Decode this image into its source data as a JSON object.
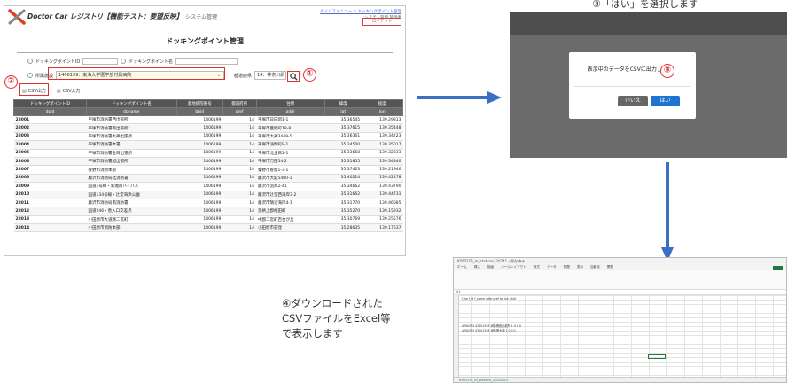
{
  "app": {
    "title": "Doctor Car レジストリ【機能テスト：要望反映】",
    "subtitle": "システム管理",
    "header_links": "ダイバスメニュー > ドッキングポイント管理",
    "header_user": "システム管理 管理者",
    "logout_label": "ログアウト",
    "page_title": "ドッキングポイント管理",
    "form": {
      "radio1_label": "ドッキングポイントID",
      "radio2_label": "ドッキングポイント名",
      "facility_label": "所属施設",
      "facility_value": "1406199：東海大学医学部付属病院",
      "pref_label": "都道府県",
      "pref_value": "14：神奈川県"
    },
    "csv_out_label": "CSV出力",
    "csv_in_label": "CSV入力",
    "table": {
      "headers": [
        "ドッキングポイントID",
        "ドッキングポイント名",
        "基地病院番号",
        "都道府県",
        "住所",
        "緯度",
        "経度"
      ],
      "subheaders": [
        "dpid",
        "dpname",
        "bhid",
        "pref",
        "addr",
        "lat",
        "lon"
      ],
      "rows": [
        [
          "28001",
          "平塚市消防署西出張所",
          "1406199",
          "14",
          "平塚市日向岡1-1",
          "35.36545",
          "139.29813"
        ],
        [
          "28002",
          "平塚市消防署南出張所",
          "1406199",
          "14",
          "平塚市豊原町18-8",
          "35.37615",
          "139.35448"
        ],
        [
          "28003",
          "平塚市消防署大神出張所",
          "1406199",
          "14",
          "平塚市大神3449-5",
          "35.36361",
          "139.34223"
        ],
        [
          "28004",
          "平塚市消防署本署",
          "1406199",
          "14",
          "平塚市浅間町9-1",
          "35.34500",
          "139.35017"
        ],
        [
          "28005",
          "平塚市消防署金目出張所",
          "1406199",
          "14",
          "平塚市北金目1-1",
          "35.33658",
          "139.32333"
        ],
        [
          "28006",
          "平塚市消防署旭出張所",
          "1406199",
          "14",
          "平塚市万田54-2",
          "35.31855",
          "139.34340"
        ],
        [
          "28007",
          "秦野市消防本部",
          "1406199",
          "14",
          "秦野市曽屋1-3-1",
          "35.37423",
          "139.21946"
        ],
        [
          "28008",
          "藤沢市消防局北消防署",
          "1406199",
          "14",
          "藤沢市大庭5480-1",
          "35.40214",
          "139.42178"
        ],
        [
          "28009",
          "国道1号線・新湘南バイパス",
          "1406199",
          "14",
          "藤沢市羽鳥2-41",
          "35.34662",
          "139.43790"
        ],
        [
          "28010",
          "国道134号線・辻堂海浜公園",
          "1406199",
          "14",
          "藤沢市辻堂西海岸3-2",
          "35.31662",
          "139.44731"
        ],
        [
          "28011",
          "藤沢市消防局南消防署",
          "1406199",
          "14",
          "藤沢市鵠沼海岸4-1",
          "35.31770",
          "139.46085"
        ],
        [
          "28012",
          "国道246・善入口交差点",
          "1406199",
          "14",
          "足柄上郡松田町",
          "35.35270",
          "139.15932"
        ],
        [
          "28013",
          "小田原市大道路二宮町",
          "1406199",
          "14",
          "中郡二宮町百合が丘",
          "35.30769",
          "139.25576"
        ],
        [
          "28014",
          "小田原市消防本部",
          "1406199",
          "14",
          "小田原市荻窪",
          "35.28635",
          "139.17637"
        ]
      ]
    }
  },
  "callouts": {
    "one": "①",
    "two": "②",
    "three": "③"
  },
  "dialog": {
    "step_caption": "③「はい」を選択します",
    "message": "表示中のデータをCSVに出力します。",
    "no_label": "いいえ",
    "yes_label": "はい"
  },
  "excel": {
    "title": "KY00373_m_stations_20241 - 保存済み",
    "tabs": [
      "ホーム",
      "挿入",
      "描画",
      "ページレイアウト",
      "数式",
      "データ",
      "校閲",
      "表示",
      "自動化",
      "開発"
    ],
    "fx": "A1",
    "header_row": "f_no   f_id   f_name   addr   pref   lat   lon   bhid",
    "data_row1": "4700373  47001703  消防署西出張所  1  0  0  0",
    "data_row2": "4700373  47001703  消防署大神  1  0  0  0",
    "sheet_tab": "KY00373_m_stations_20241007"
  },
  "caption4": [
    "④ダウンロードされた",
    "CSVファイルをExcel等",
    "で表示します"
  ]
}
